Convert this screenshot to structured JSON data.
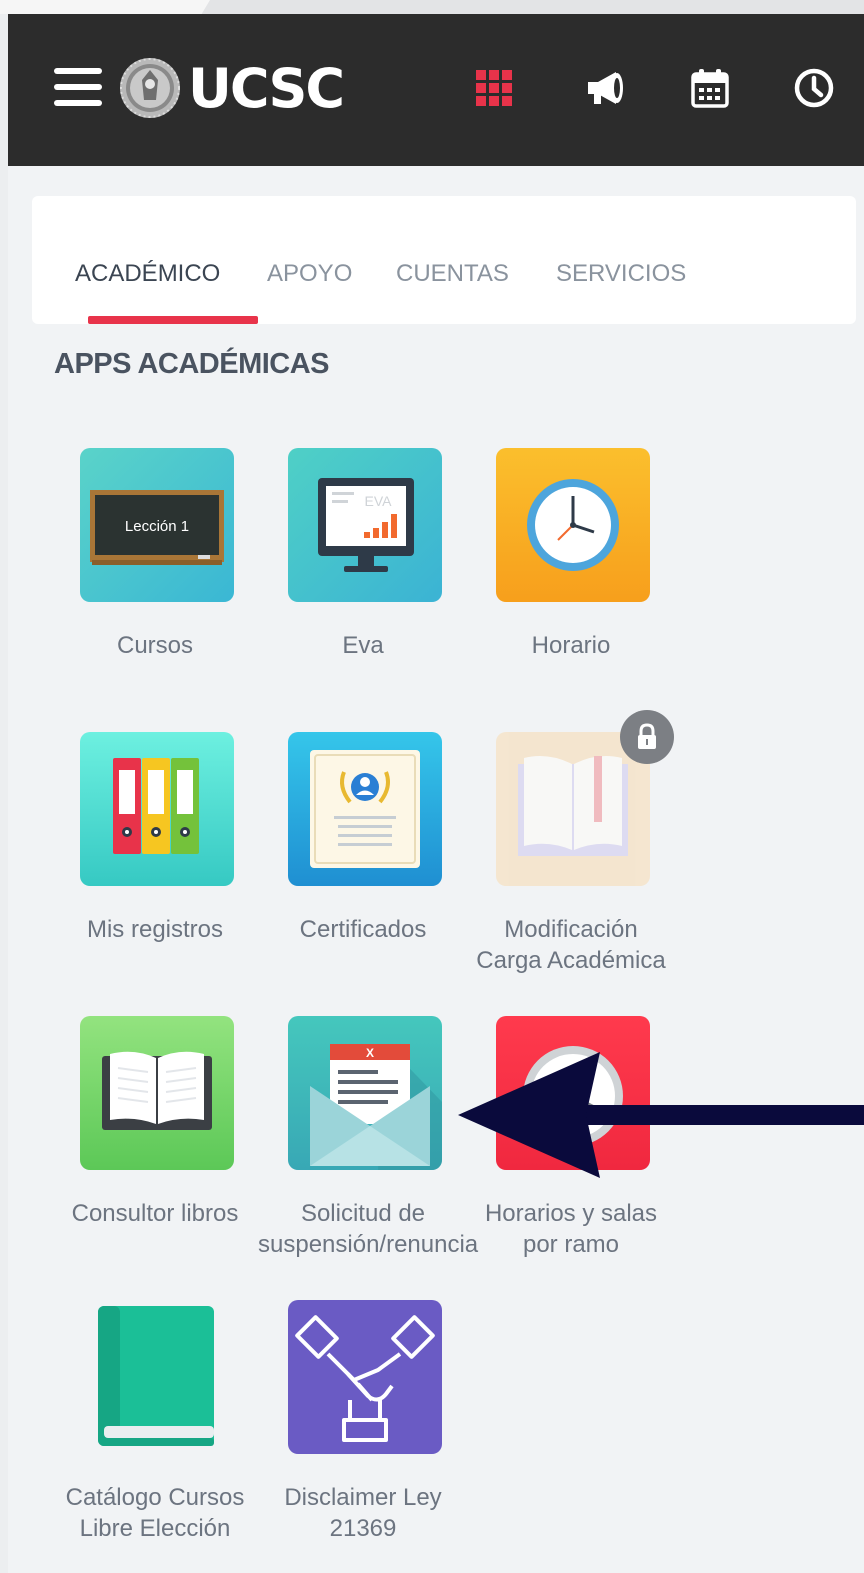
{
  "header": {
    "logo_text": "UCSC",
    "accent_color": "#e8334a",
    "icons": [
      "menu-icon",
      "university-seal-icon",
      "apps-grid-icon",
      "megaphone-icon",
      "calendar-icon",
      "clock-icon"
    ]
  },
  "tabs": [
    {
      "label": "ACADÉMICO",
      "active": true
    },
    {
      "label": "APOYO",
      "active": false
    },
    {
      "label": "CUENTAS",
      "active": false
    },
    {
      "label": "SERVICIOS",
      "active": false
    }
  ],
  "section": {
    "title": "APPS ACADÉMICAS"
  },
  "apps": [
    {
      "label_lines": [
        "Cursos"
      ],
      "icon": "chalkboard-icon",
      "chalkboard_text": "Lección 1",
      "locked": false
    },
    {
      "label_lines": [
        "Eva"
      ],
      "icon": "monitor-chart-icon",
      "screen_text": "EVA",
      "locked": false
    },
    {
      "label_lines": [
        "Horario"
      ],
      "icon": "wall-clock-icon",
      "locked": false
    },
    {
      "label_lines": [
        "Mis registros"
      ],
      "icon": "binders-icon",
      "locked": false
    },
    {
      "label_lines": [
        "Certificados"
      ],
      "icon": "certificate-icon",
      "locked": false
    },
    {
      "label_lines": [
        "Modificación",
        "Carga Académica"
      ],
      "icon": "open-book-icon",
      "locked": true
    },
    {
      "label_lines": [
        "Consultor libros"
      ],
      "icon": "open-book-icon",
      "locked": false
    },
    {
      "label_lines": [
        "Solicitud de",
        "suspensión/renuncia"
      ],
      "icon": "envelope-letter-icon",
      "letter_mark": "X",
      "locked": false
    },
    {
      "label_lines": [
        "Horarios y salas",
        "por ramo"
      ],
      "icon": "clock-icon",
      "locked": false
    },
    {
      "label_lines": [
        "Catálogo Cursos",
        "Libre Elección"
      ],
      "icon": "closed-book-icon",
      "locked": false
    },
    {
      "label_lines": [
        "Disclaimer Ley",
        "21369"
      ],
      "icon": "handshake-icon",
      "locked": false
    }
  ],
  "annotation": {
    "type": "arrow",
    "points_to": "Solicitud de suspensión/renuncia",
    "color": "#0a0a3c"
  }
}
